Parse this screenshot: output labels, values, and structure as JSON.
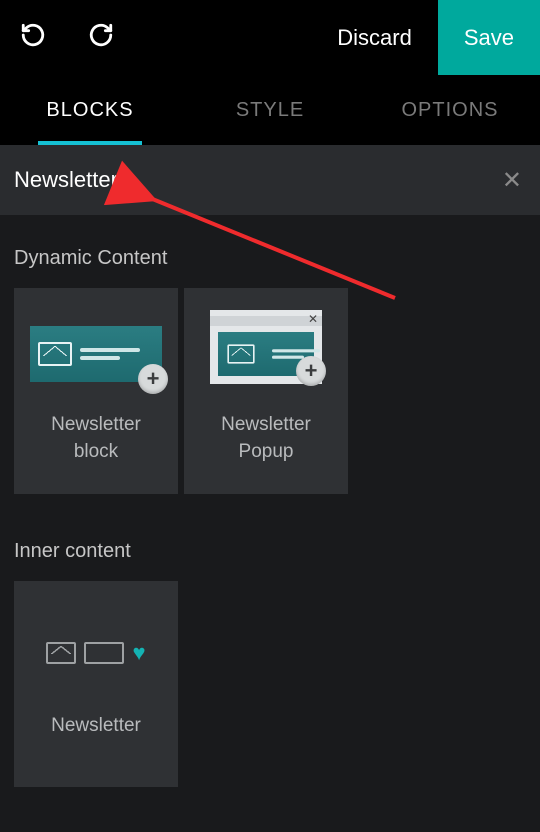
{
  "toolbar": {
    "discard_label": "Discard",
    "save_label": "Save"
  },
  "tabs": [
    {
      "label": "BLOCKS",
      "active": true
    },
    {
      "label": "STYLE",
      "active": false
    },
    {
      "label": "OPTIONS",
      "active": false
    }
  ],
  "search": {
    "value": "Newsletter"
  },
  "sections": [
    {
      "title": "Dynamic Content",
      "blocks": [
        {
          "label": "Newsletter\nblock"
        },
        {
          "label": "Newsletter\nPopup"
        }
      ]
    },
    {
      "title": "Inner content",
      "blocks": [
        {
          "label": "Newsletter"
        }
      ]
    }
  ],
  "colors": {
    "accent": "#00a99d",
    "tab_underline": "#15c1d4"
  }
}
